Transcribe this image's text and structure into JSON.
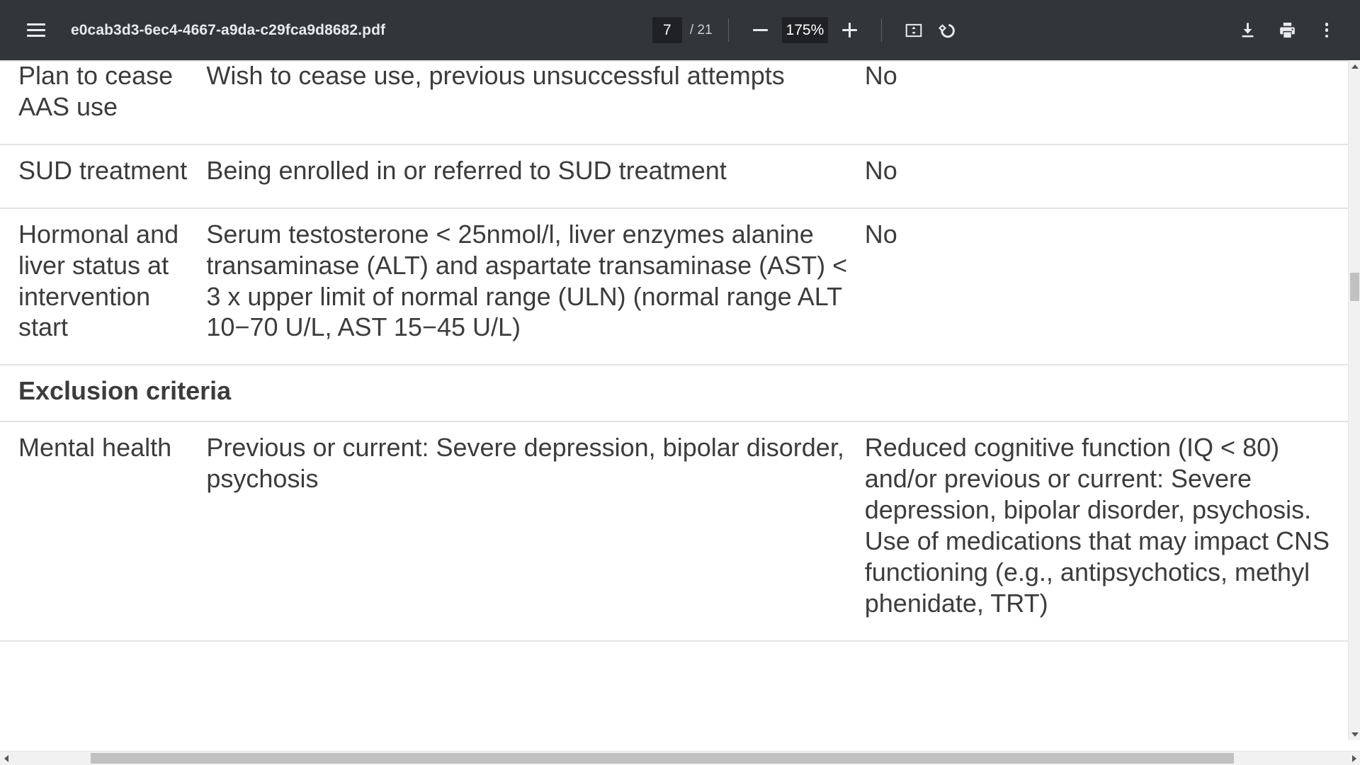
{
  "toolbar": {
    "menu_icon": "hamburger-menu-icon",
    "document_title": "e0cab3d3-6ec4-4667-a9da-c29fca9d8682.pdf",
    "page_current": "7",
    "page_total": "/ 21",
    "zoom_out_icon": "minus-icon",
    "zoom_level": "175%",
    "zoom_in_icon": "plus-icon",
    "fit_page_icon": "fit-to-page-icon",
    "rotate_icon": "rotate-clockwise-icon",
    "download_icon": "download-icon",
    "print_icon": "print-icon",
    "more_icon": "more-vertical-icon",
    "colors": {
      "toolbar_bg": "#323639",
      "toolbar_text": "#e8eaed",
      "field_bg": "#202124"
    }
  },
  "document": {
    "text_color": "#3c3c3c",
    "rule_color": "#e3e3e3",
    "rows": [
      {
        "type": "data",
        "col1": "Plan to cease AAS use",
        "col2": "Wish to cease use, previous unsuccessful attempts",
        "col3": "No"
      },
      {
        "type": "data",
        "col1": "SUD treatment",
        "col2": "Being enrolled in or referred to SUD treatment",
        "col3": "No"
      },
      {
        "type": "data",
        "col1": "Hormonal and liver status at intervention start",
        "col2": "Serum testosterone < 25nmol/l, liver enzymes alanine transaminase (ALT) and aspartate transaminase (AST) < 3 x upper limit of normal range (ULN) (normal range ALT 10−70 U/L, AST 15−45 U/L)",
        "col3": "No"
      },
      {
        "type": "section",
        "col1": "Exclusion criteria",
        "col2": "",
        "col3": ""
      },
      {
        "type": "data",
        "col1": "Mental health",
        "col2": "Previous or current: Severe depression, bipolar disorder, psychosis",
        "col3": "Reduced cognitive function (IQ < 80) and/or previous or current: Severe depression, bipolar disorder, psychosis. Use of medications that may impact CNS functioning (e.g., antipsychotics, methyl phenidate, TRT)"
      }
    ]
  },
  "scrollbars": {
    "vertical_up_icon": "scroll-up-arrow-icon",
    "vertical_down_icon": "scroll-down-arrow-icon",
    "horizontal_left_icon": "scroll-left-arrow-icon",
    "horizontal_right_icon": "scroll-right-arrow-icon"
  }
}
